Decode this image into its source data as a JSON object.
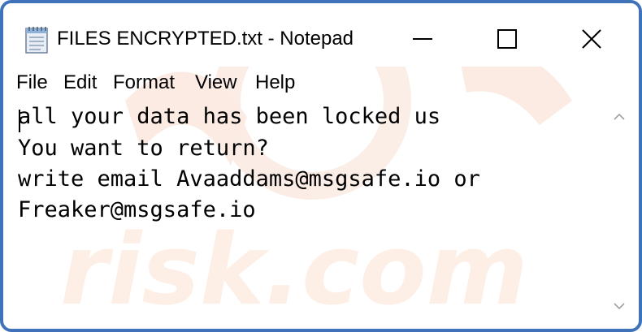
{
  "window": {
    "title": "FILES ENCRYPTED.txt - Notepad",
    "icon": "notepad-icon",
    "buttons": {
      "minimize_icon": "minimize-icon",
      "maximize_icon": "maximize-icon",
      "close_icon": "close-icon"
    },
    "border_color": "#3f72b9"
  },
  "menu": {
    "items": [
      "File",
      "Edit",
      "Format",
      "View",
      "Help"
    ]
  },
  "editor": {
    "lines": [
      "all your data has been locked us",
      "You want to return?",
      "write email Avaaddams@msgsafe.io or",
      "Freaker@msgsafe.io"
    ]
  },
  "watermark": {
    "text": "risk.com",
    "color": "#fbe3d6"
  }
}
